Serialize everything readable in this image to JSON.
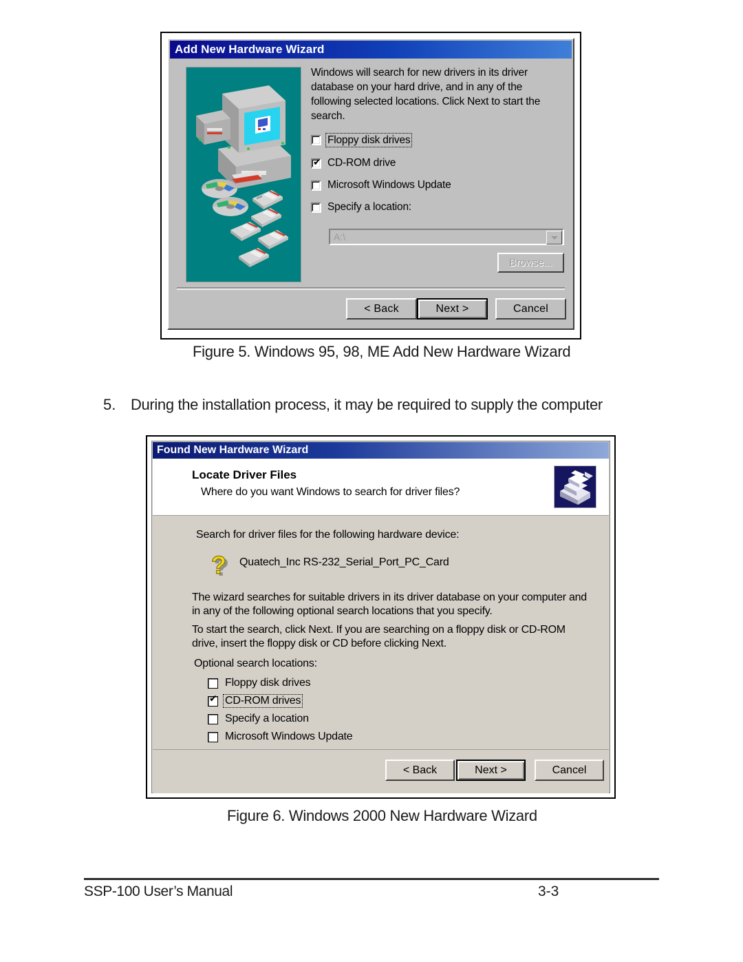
{
  "figure5": {
    "caption": "Figure 5. Windows 95, 98, ME Add New Hardware Wizard",
    "dialog": {
      "title": "Add New Hardware Wizard",
      "intro": "Windows will search for new drivers in its driver database on your hard drive, and in any of the following selected locations. Click Next to start the search.",
      "checkboxes": [
        {
          "label": "Floppy disk drives",
          "checked": false,
          "focused": true
        },
        {
          "label": "CD-ROM drive",
          "checked": true,
          "focused": false
        },
        {
          "label": "Microsoft Windows Update",
          "checked": false,
          "focused": false
        },
        {
          "label": "Specify a location:",
          "checked": false,
          "focused": false
        }
      ],
      "location_combo": {
        "value": "A:\\",
        "disabled": true
      },
      "browse_label": "Browse...",
      "buttons": {
        "back": "< Back",
        "next": "Next >",
        "cancel": "Cancel"
      },
      "illustration": "computer-cd-floppy-illustration"
    }
  },
  "step5": {
    "number": "5.",
    "text": "During the installation process, it may be required to supply the computer"
  },
  "figure6": {
    "caption": "Figure 6. Windows 2000 New Hardware Wizard",
    "dialog": {
      "title": "Found New Hardware Wizard",
      "header_title": "Locate Driver Files",
      "header_subtitle": "Where do you want Windows to search for driver files?",
      "header_icon": "hardware-install-icon",
      "search_prompt": "Search for driver files for the following hardware device:",
      "device_icon": "question-mark-icon",
      "device_name": "Quatech_Inc RS-232_Serial_Port_PC_Card",
      "paragraph1": "The wizard searches for suitable drivers in its driver database on your computer and in any of the following optional search locations that you specify.",
      "paragraph2": "To start the search, click Next. If you are searching on a floppy disk or CD-ROM drive, insert the floppy disk or CD before clicking Next.",
      "optional_label": "Optional search locations:",
      "checkboxes": [
        {
          "label": "Floppy disk drives",
          "checked": false,
          "focused": false
        },
        {
          "label": "CD-ROM drives",
          "checked": true,
          "focused": true
        },
        {
          "label": "Specify a location",
          "checked": false,
          "focused": false
        },
        {
          "label": "Microsoft Windows Update",
          "checked": false,
          "focused": false
        }
      ],
      "buttons": {
        "back": "< Back",
        "next": "Next >",
        "cancel": "Cancel"
      }
    }
  },
  "footer": {
    "left": "SSP-100 User’s Manual",
    "page": "3-3"
  },
  "colors": {
    "w95_titlebar": "#0a0a8c",
    "w95_face": "#c0c0c0",
    "w95_illustration_bg": "#008080",
    "w2k_titlebar": "#0c1a72",
    "w2k_face": "#d4d0c8",
    "w2k_icon_bg": "#151560",
    "question_icon": "#f2d81e"
  }
}
